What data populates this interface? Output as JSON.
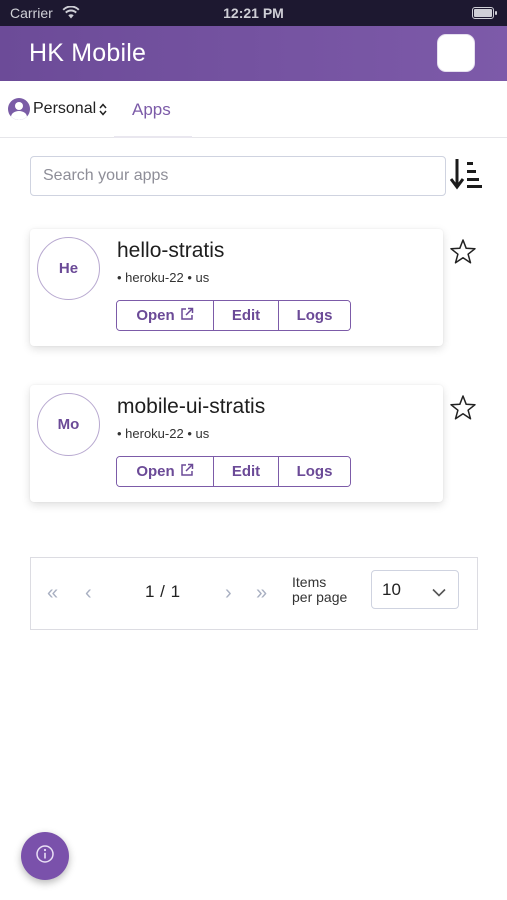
{
  "status_bar": {
    "carrier": "Carrier",
    "time": "12:21 PM"
  },
  "header": {
    "title": "HK Mobile"
  },
  "team_selector": {
    "label": "Personal"
  },
  "tabs": [
    {
      "label": "Apps",
      "active": true
    }
  ],
  "search": {
    "placeholder": "Search your apps",
    "value": ""
  },
  "apps": [
    {
      "initials": "He",
      "name": "hello-stratis",
      "stack": "heroku-22",
      "region": "us",
      "meta": "• heroku-22 • us",
      "open_label": "Open",
      "edit_label": "Edit",
      "logs_label": "Logs",
      "favorite": false
    },
    {
      "initials": "Mo",
      "name": "mobile-ui-stratis",
      "stack": "heroku-22",
      "region": "us",
      "meta": "• heroku-22 • us",
      "open_label": "Open",
      "edit_label": "Edit",
      "logs_label": "Logs",
      "favorite": false
    }
  ],
  "pagination": {
    "first_icon": "«",
    "prev_icon": "‹",
    "next_icon": "›",
    "last_icon": "»",
    "page_status": "1 / 1",
    "items_per_page_line1": "Items",
    "items_per_page_line2": "per page",
    "page_size": "10"
  },
  "icons": {
    "wifi": "wifi-icon",
    "battery": "battery-icon",
    "team_avatar": "user-avatar-icon",
    "sort": "sort-icon",
    "external_link": "external-link-icon",
    "star": "star-outline-icon",
    "info": "info-icon",
    "chevron_down": "chevron-down-icon"
  },
  "colors": {
    "brand": "#7d5aa9",
    "status_bar": "#1d1830",
    "button_text": "#6b4a97",
    "fab": "#7a51ab"
  }
}
